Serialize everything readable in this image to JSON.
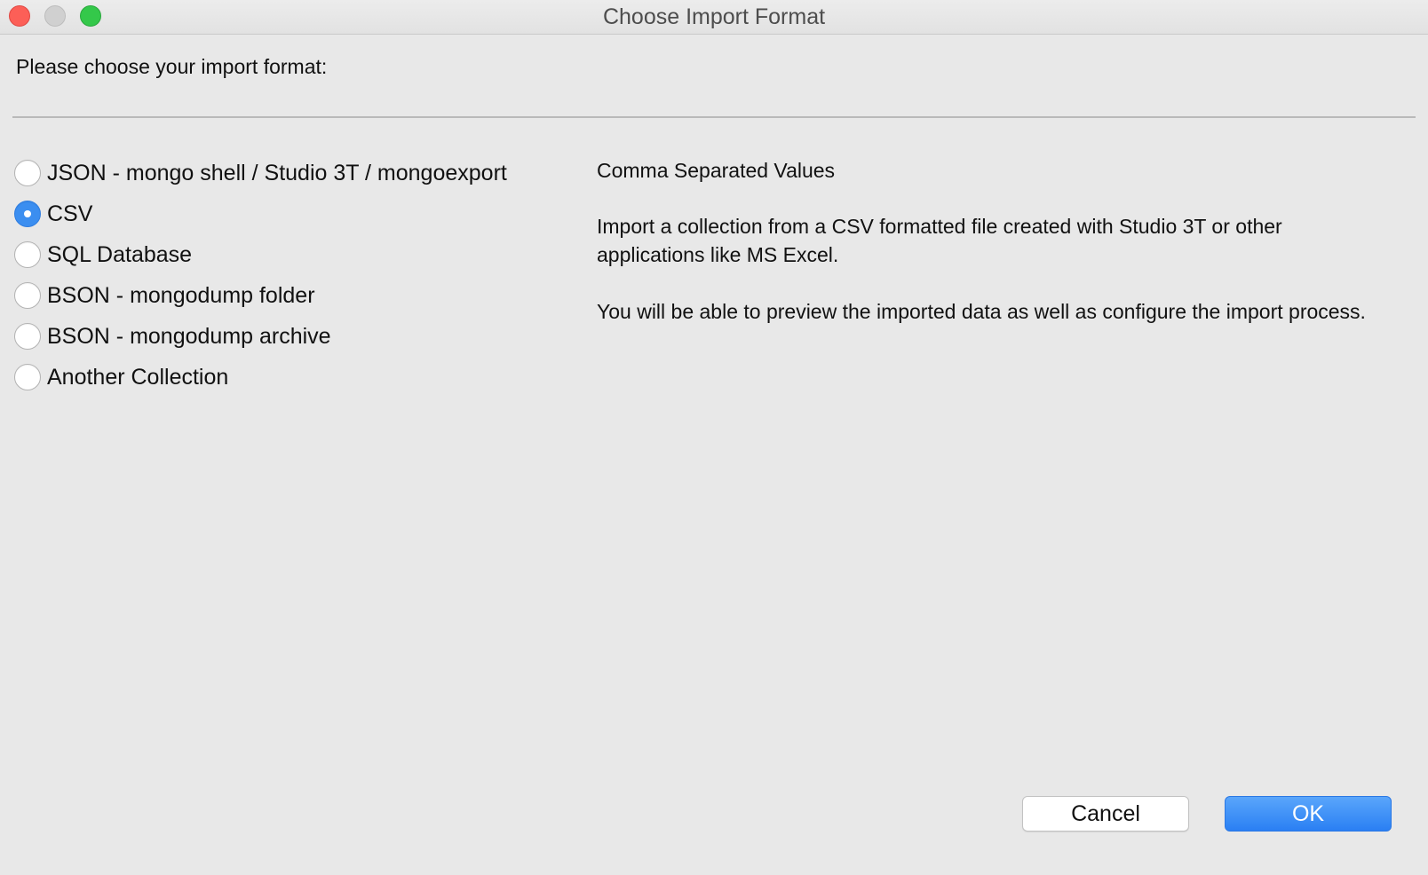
{
  "window": {
    "title": "Choose Import Format",
    "controls": {
      "close": "close-icon",
      "minimize": "minimize-icon",
      "zoom": "zoom-icon"
    }
  },
  "prompt": "Please choose your import format:",
  "formats": [
    {
      "label": "JSON - mongo shell / Studio 3T / mongoexport",
      "selected": false
    },
    {
      "label": "CSV",
      "selected": true
    },
    {
      "label": "SQL Database",
      "selected": false
    },
    {
      "label": "BSON - mongodump folder",
      "selected": false
    },
    {
      "label": "BSON - mongodump archive",
      "selected": false
    },
    {
      "label": "Another Collection",
      "selected": false
    }
  ],
  "description": {
    "heading": "Comma Separated Values",
    "paragraph1": "Import a collection from a CSV formatted file created with Studio 3T or other applications like MS Excel.",
    "paragraph2": "You will be able to preview the imported data as well as configure the import process."
  },
  "buttons": {
    "cancel": "Cancel",
    "ok": "OK"
  },
  "colors": {
    "accent": "#3b8ef0",
    "background": "#e8e8e8",
    "close": "#fc5f57",
    "zoom": "#34c84a"
  }
}
